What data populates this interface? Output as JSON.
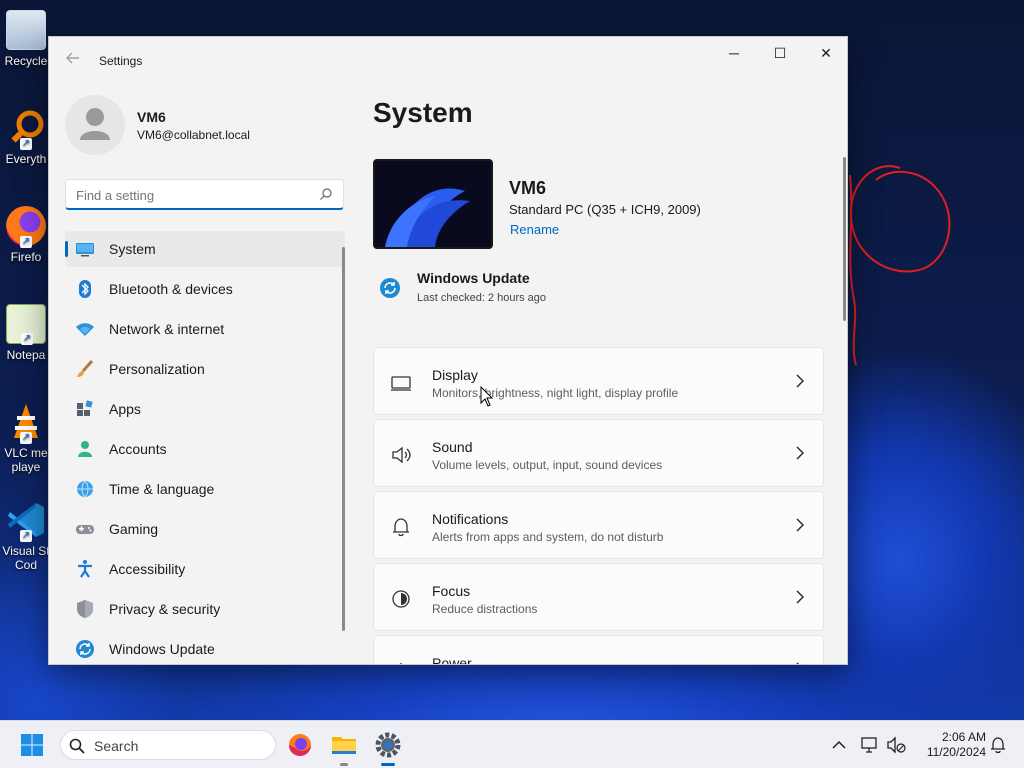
{
  "desktop": {
    "icons": [
      {
        "label": "Recycle",
        "icon": "recycle-bin-icon"
      },
      {
        "label": "Everyth",
        "icon": "everything-search-icon"
      },
      {
        "label": "Firefo",
        "icon": "firefox-icon"
      },
      {
        "label": "Notepa",
        "icon": "notepad-plus-plus-icon"
      },
      {
        "label": "VLC me playe",
        "icon": "vlc-icon"
      },
      {
        "label": "Visual St Cod",
        "icon": "vscode-icon"
      }
    ]
  },
  "window": {
    "title": "Settings",
    "controls": {
      "minimize": "─",
      "maximize": "☐",
      "close": "✕"
    }
  },
  "profile": {
    "name": "VM6",
    "email": "VM6@collabnet.local"
  },
  "search": {
    "placeholder": "Find a setting",
    "value": ""
  },
  "sidebar": {
    "items": [
      {
        "label": "System",
        "icon": "system-display-icon",
        "active": true
      },
      {
        "label": "Bluetooth & devices",
        "icon": "bluetooth-icon"
      },
      {
        "label": "Network & internet",
        "icon": "wifi-icon"
      },
      {
        "label": "Personalization",
        "icon": "paintbrush-icon"
      },
      {
        "label": "Apps",
        "icon": "apps-icon"
      },
      {
        "label": "Accounts",
        "icon": "accounts-icon"
      },
      {
        "label": "Time & language",
        "icon": "globe-clock-icon"
      },
      {
        "label": "Gaming",
        "icon": "gamepad-icon"
      },
      {
        "label": "Accessibility",
        "icon": "accessibility-icon"
      },
      {
        "label": "Privacy & security",
        "icon": "shield-icon"
      },
      {
        "label": "Windows Update",
        "icon": "windows-update-icon"
      }
    ]
  },
  "main": {
    "title": "System",
    "device": {
      "name": "VM6",
      "model": "Standard PC (Q35 + ICH9, 2009)",
      "rename_label": "Rename"
    },
    "windows_update": {
      "title": "Windows Update",
      "subtitle": "Last checked: 2 hours ago"
    },
    "cards": [
      {
        "title": "Display",
        "subtitle": "Monitors, brightness, night light, display profile",
        "icon": "monitor-icon"
      },
      {
        "title": "Sound",
        "subtitle": "Volume levels, output, input, sound devices",
        "icon": "speaker-icon"
      },
      {
        "title": "Notifications",
        "subtitle": "Alerts from apps and system, do not disturb",
        "icon": "bell-icon"
      },
      {
        "title": "Focus",
        "subtitle": "Reduce distractions",
        "icon": "focus-icon"
      },
      {
        "title": "Power",
        "subtitle": "",
        "icon": "power-icon"
      }
    ]
  },
  "taskbar": {
    "search_label": "Search",
    "apps": [
      "firefox-icon",
      "file-explorer-icon",
      "settings-gear-icon"
    ],
    "clock": {
      "time": "2:06 AM",
      "date": "11/20/2024"
    }
  },
  "colors": {
    "accent": "#0067c0",
    "window_bg": "#f3f3f3",
    "card_bg": "#fbfbfb",
    "scribble": "#e02020"
  }
}
